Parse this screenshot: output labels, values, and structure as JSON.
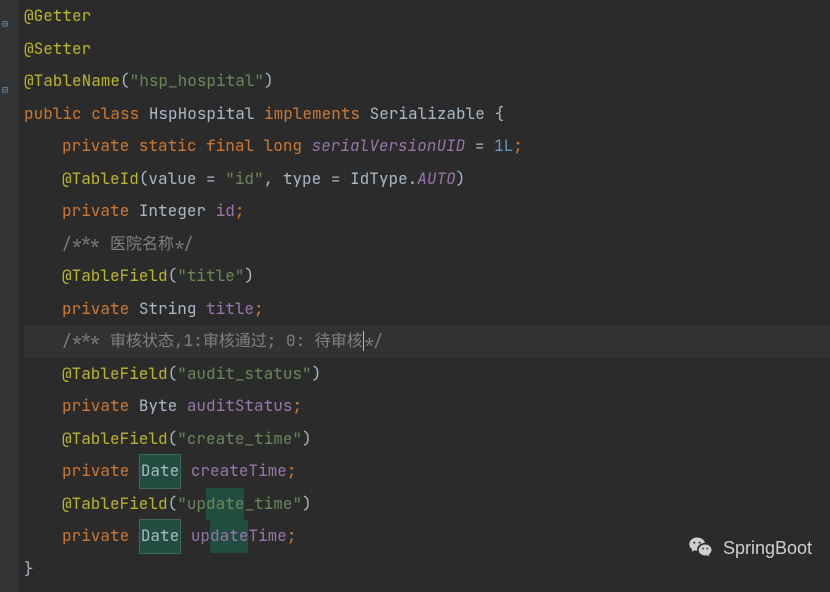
{
  "code": {
    "line1": {
      "annotation": "@Getter"
    },
    "line2": {
      "annotation": "@Setter"
    },
    "line3": {
      "annotation": "@TableName",
      "lparen": "(",
      "str": "\"hsp_hospital\"",
      "rparen": ")"
    },
    "line4": {
      "kw1": "public ",
      "kw2": "class ",
      "cls": "HspHospital ",
      "kw3": "implements ",
      "iface": "Serializable ",
      "brace": "{"
    },
    "line5": {
      "kw1": "private ",
      "kw2": "static ",
      "kw3": "final ",
      "kw4": "long ",
      "field": "serialVersionUID",
      "eq": " = ",
      "num": "1L",
      "semi": ";"
    },
    "line6": {
      "annotation": "@TableId",
      "lparen": "(",
      "p1": "value ",
      "eq1": "= ",
      "str1": "\"id\"",
      "comma": ", ",
      "p2": "type ",
      "eq2": "= ",
      "enum1": "IdType.",
      "enum2": "AUTO",
      "rparen": ")"
    },
    "line7": {
      "kw": "private ",
      "type": "Integer ",
      "field": "id",
      "semi": ";"
    },
    "line8": {
      "comment": "/*** 医院名称*/"
    },
    "line9": {
      "annotation": "@TableField",
      "lparen": "(",
      "str": "\"title\"",
      "rparen": ")"
    },
    "line10": {
      "kw": "private ",
      "type": "String ",
      "field": "title",
      "semi": ";"
    },
    "line11": {
      "commentStart": "/*** 审核状态,1:审核通过; 0: 待审核",
      "commentEnd": "*/"
    },
    "line12": {
      "annotation": "@TableField",
      "lparen": "(",
      "str": "\"audit_status\"",
      "rparen": ")"
    },
    "line13": {
      "kw": "private ",
      "type": "Byte ",
      "field": "auditStatus",
      "semi": ";"
    },
    "line14": {
      "annotation": "@TableField",
      "lparen": "(",
      "str": "\"create_time\"",
      "rparen": ")"
    },
    "line15": {
      "kw": "private ",
      "type": "Date",
      "sp": " ",
      "field": "createTime",
      "semi": ";"
    },
    "line16": {
      "annotation": "@TableField",
      "lparen": "(",
      "strPre": "\"up",
      "strHl": "date",
      "strPost": "_time\"",
      "rparen": ")"
    },
    "line17": {
      "kw": "private ",
      "type": "Date",
      "sp": " ",
      "fieldPre": "up",
      "fieldHl": "date",
      "fieldPost": "Time",
      "semi": ";"
    },
    "line18": {
      "brace": "}"
    }
  },
  "watermark": {
    "text": "SpringBoot"
  }
}
